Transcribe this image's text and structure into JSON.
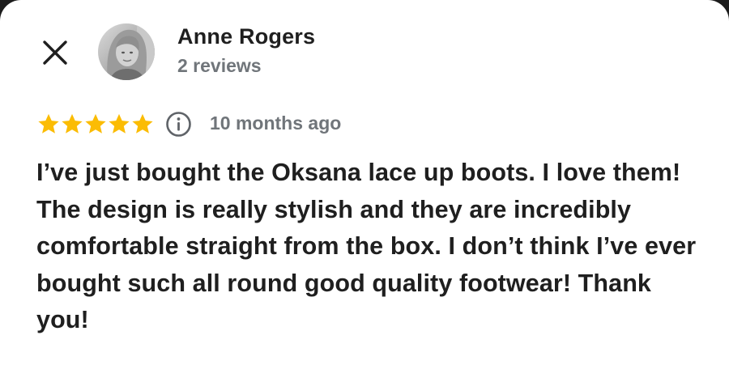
{
  "reviewer": {
    "name": "Anne Rogers",
    "reviews_count": "2 reviews"
  },
  "review": {
    "rating": 5,
    "rating_max": 5,
    "star_color": "#fbbc04",
    "time_ago": "10 months ago",
    "text": "I’ve just bought the Oksana lace up boots. I love them! The design is really stylish and they are incredibly comfortable straight from the box. I don’t think I’ve ever bought such all round good quality footwear! Thank you!"
  },
  "icons": {
    "close": "close-icon",
    "info": "info-icon",
    "star": "star-icon"
  },
  "colors": {
    "text_primary": "#1f1f1f",
    "text_secondary": "#70757a",
    "background": "#ffffff"
  }
}
